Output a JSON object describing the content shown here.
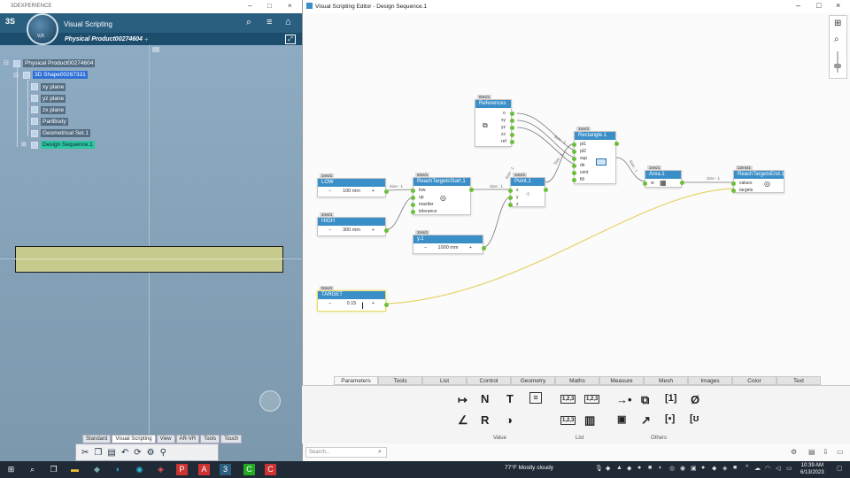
{
  "left_window": {
    "title": "3DEXPERIENCE",
    "app_name": "Visual Scripting",
    "compass_label": "V,R",
    "tab": "Physical Product00274604",
    "tab_plus": "+",
    "tree": [
      {
        "label": "Physical Product00274604"
      },
      {
        "label": "3D Shape00267331"
      },
      {
        "label": "xy plane"
      },
      {
        "label": "yz plane"
      },
      {
        "label": "zx plane"
      },
      {
        "label": "PartBody"
      },
      {
        "label": "Geometrical Set.1"
      },
      {
        "label": "Design Sequence.1"
      }
    ],
    "toolbar_tabs": [
      "Standard",
      "Visual Scripting",
      "View",
      "AR-VR",
      "Tools",
      "Touch"
    ]
  },
  "editor": {
    "title": "Visual Scripting Editor - Design Sequence.1",
    "nodes": {
      "references": {
        "tag": "0ms/1",
        "title": "References",
        "ports": [
          "o",
          "xy",
          "yz",
          "zx",
          "ref"
        ]
      },
      "rectangle": {
        "tag": "1ms/1",
        "title": "Rectangle.1",
        "ports": [
          "pt1",
          "pt2",
          "sup",
          "dir",
          "cent",
          "fill"
        ]
      },
      "low": {
        "tag": "1ms/1",
        "title": "LOW",
        "value": "100 mm",
        "minus": "−",
        "plus": "+"
      },
      "high": {
        "tag": "1ms/1",
        "title": "HIGH",
        "value": "300 mm",
        "minus": "−",
        "plus": "+"
      },
      "reach_start": {
        "tag": "2ms/1",
        "title": "ReachTargetsStart.1",
        "ports": [
          "low",
          "up",
          "maxIter",
          "tolerance"
        ]
      },
      "point": {
        "tag": "1ms/1",
        "title": "Point.1",
        "ports": [
          "x",
          "y",
          "z"
        ]
      },
      "y1": {
        "tag": "1ms/1",
        "title": "y.1",
        "value": "1000 mm",
        "minus": "−",
        "plus": "+"
      },
      "area": {
        "tag": "1ms/1",
        "title": "Area.1",
        "ports": [
          "w"
        ]
      },
      "reach_end": {
        "tag": "12ms/1",
        "title": "ReachTargetsEnd.1",
        "ports": [
          "values",
          "targets"
        ]
      },
      "target": {
        "tag": "0ms/1",
        "title": "TARGET",
        "value": "0.15",
        "minus": "−",
        "plus": "+"
      }
    },
    "wire_labels": [
      "Size : 1",
      "Size : 1",
      "Size : 1",
      "Size : 1",
      "Size : 1",
      "Size : 1",
      "Size : 1"
    ],
    "library_tabs": [
      "Parameters",
      "Tools",
      "List",
      "Control",
      "Geometry",
      "Maths",
      "Measure",
      "Mesh",
      "Images",
      "Color",
      "Text"
    ],
    "library_categories": {
      "value": "Value",
      "list": "List",
      "others": "Others"
    },
    "library_icons": {
      "n_label": "N",
      "t_label": "T",
      "r_label": "R",
      "list_123_a": "1,2,3",
      "list_123_b": "1,2,3",
      "list_123_c": "1,2,3",
      "list_123_d": "1,2,3",
      "bracket_1": "[1]",
      "empty_set": "Ø"
    },
    "search_placeholder": "Search..."
  },
  "taskbar": {
    "weather": "77°F  Mostly cloudy",
    "time": "10:39 AM",
    "date": "6/13/2023"
  }
}
